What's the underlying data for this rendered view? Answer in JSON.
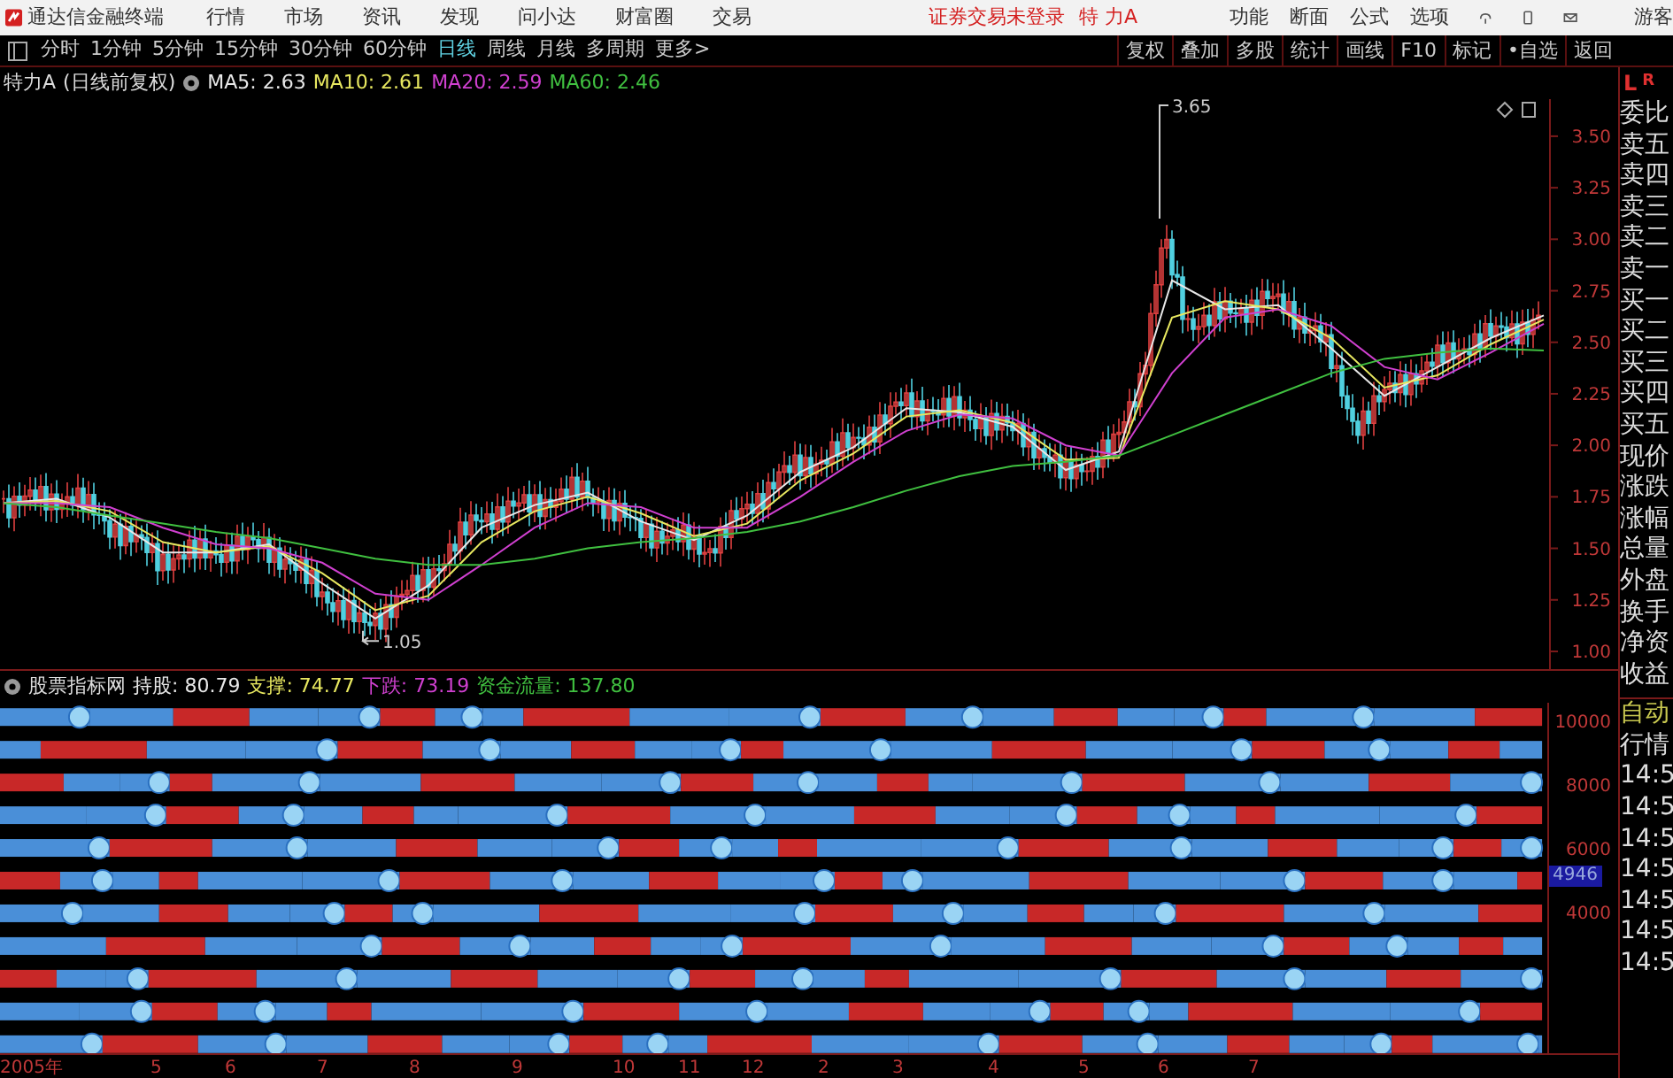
{
  "title_bar": {
    "app_name": "通达信金融终端",
    "menus": [
      "行情",
      "市场",
      "资讯",
      "发现",
      "问小达",
      "财富圈",
      "交易"
    ],
    "login_status": "证券交易未登录",
    "stock": "特 力A",
    "tools": [
      "功能",
      "断面",
      "公式",
      "选项"
    ],
    "user": "游客"
  },
  "period_bar": {
    "periods": [
      {
        "label": "分时",
        "selected": false
      },
      {
        "label": "1分钟",
        "selected": false
      },
      {
        "label": "5分钟",
        "selected": false
      },
      {
        "label": "15分钟",
        "selected": false
      },
      {
        "label": "30分钟",
        "selected": false
      },
      {
        "label": "60分钟",
        "selected": false
      },
      {
        "label": "日线",
        "selected": true
      },
      {
        "label": "周线",
        "selected": false
      },
      {
        "label": "月线",
        "selected": false
      },
      {
        "label": "多周期",
        "selected": false
      },
      {
        "label": "更多>",
        "selected": false
      }
    ],
    "actions": [
      "复权",
      "叠加",
      "多股",
      "统计",
      "画线",
      "F10",
      "标记",
      "•自选",
      "返回"
    ]
  },
  "chart": {
    "stock_label": "特力A",
    "mode": "(日线前复权)",
    "legend": [
      {
        "label": "MA5:",
        "value": "2.63"
      },
      {
        "label": "MA10:",
        "value": "2.61"
      },
      {
        "label": "MA20:",
        "value": "2.59"
      },
      {
        "label": "MA60:",
        "value": "2.46"
      }
    ],
    "peak_label": "3.65",
    "low_label": "1.05",
    "chart_data": {
      "type": "line",
      "ylim": [
        0.914,
        3.68
      ],
      "yticks": [
        {
          "value": 3.5,
          "label": "3.50"
        },
        {
          "value": 3.25,
          "label": "3.25"
        },
        {
          "value": 3.0,
          "label": "3.00"
        },
        {
          "value": 2.75,
          "label": "2.75"
        },
        {
          "value": 2.5,
          "label": "2.50"
        },
        {
          "value": 2.25,
          "label": "2.25"
        },
        {
          "value": 2.0,
          "label": "2.00"
        },
        {
          "value": 1.75,
          "label": "1.75"
        },
        {
          "value": 1.5,
          "label": "1.50"
        },
        {
          "value": 1.25,
          "label": "1.25"
        },
        {
          "value": 1.0,
          "label": "1.00"
        }
      ],
      "series": [
        {
          "color": "#e8e8e8",
          "values": [
            1.72,
            1.74,
            1.65,
            1.48,
            1.48,
            1.52,
            1.33,
            1.16,
            1.32,
            1.6,
            1.71,
            1.77,
            1.63,
            1.54,
            1.66,
            1.87,
            1.99,
            2.18,
            2.16,
            2.09,
            1.88,
            1.97,
            2.8,
            2.66,
            2.68,
            2.47,
            2.24,
            2.38,
            2.52,
            2.63
          ]
        },
        {
          "color": "#e8e860",
          "values": [
            1.72,
            1.73,
            1.68,
            1.53,
            1.48,
            1.51,
            1.38,
            1.2,
            1.27,
            1.53,
            1.68,
            1.75,
            1.67,
            1.56,
            1.62,
            1.83,
            1.96,
            2.14,
            2.17,
            2.11,
            1.93,
            1.94,
            2.62,
            2.7,
            2.66,
            2.52,
            2.28,
            2.34,
            2.49,
            2.61
          ]
        },
        {
          "color": "#d040d0",
          "values": [
            1.72,
            1.72,
            1.7,
            1.6,
            1.52,
            1.5,
            1.43,
            1.28,
            1.25,
            1.42,
            1.6,
            1.72,
            1.7,
            1.6,
            1.6,
            1.75,
            1.92,
            2.07,
            2.15,
            2.13,
            2.0,
            1.95,
            2.35,
            2.62,
            2.66,
            2.58,
            2.38,
            2.32,
            2.45,
            2.59
          ]
        },
        {
          "color": "#40c040",
          "values": [
            1.72,
            1.7,
            1.66,
            1.62,
            1.58,
            1.55,
            1.5,
            1.45,
            1.42,
            1.42,
            1.45,
            1.5,
            1.53,
            1.55,
            1.58,
            1.63,
            1.7,
            1.78,
            1.85,
            1.9,
            1.92,
            1.95,
            2.05,
            2.15,
            2.25,
            2.35,
            2.42,
            2.45,
            2.47,
            2.46
          ]
        }
      ]
    }
  },
  "indicator_panel": {
    "name": "股票指标网",
    "values": [
      {
        "label": "持股:",
        "value": "80.79",
        "color": "#e8e8e8"
      },
      {
        "label": "支撑:",
        "value": "74.77",
        "color": "#e8e860"
      },
      {
        "label": "下跌:",
        "value": "73.19",
        "color": "#d040d0"
      },
      {
        "label": "资金流量:",
        "value": "137.80",
        "color": "#40c040"
      }
    ],
    "y_axis": [
      "10000",
      "8000",
      "6000",
      "4000"
    ],
    "cursor_value": "4946"
  },
  "x_axis": [
    "2005年",
    "5",
    "6",
    "7",
    "8",
    "9",
    "10",
    "11",
    "12",
    "2",
    "3",
    "4",
    "5",
    "6",
    "7"
  ],
  "side_panel": {
    "header": [
      "L",
      "R"
    ],
    "fields": [
      "委比",
      "卖五",
      "卖四",
      "卖三",
      "卖二",
      "卖一",
      "买一",
      "买二",
      "买三",
      "买四",
      "买五",
      "现价",
      "涨跌",
      "涨幅",
      "总量",
      "外盘",
      "换手",
      "净资",
      "收益"
    ],
    "tabs": [
      "自动",
      "行情"
    ],
    "times": [
      "14:5",
      "14:5",
      "14:5",
      "14:5",
      "14:5",
      "14:5",
      "14:5"
    ]
  }
}
